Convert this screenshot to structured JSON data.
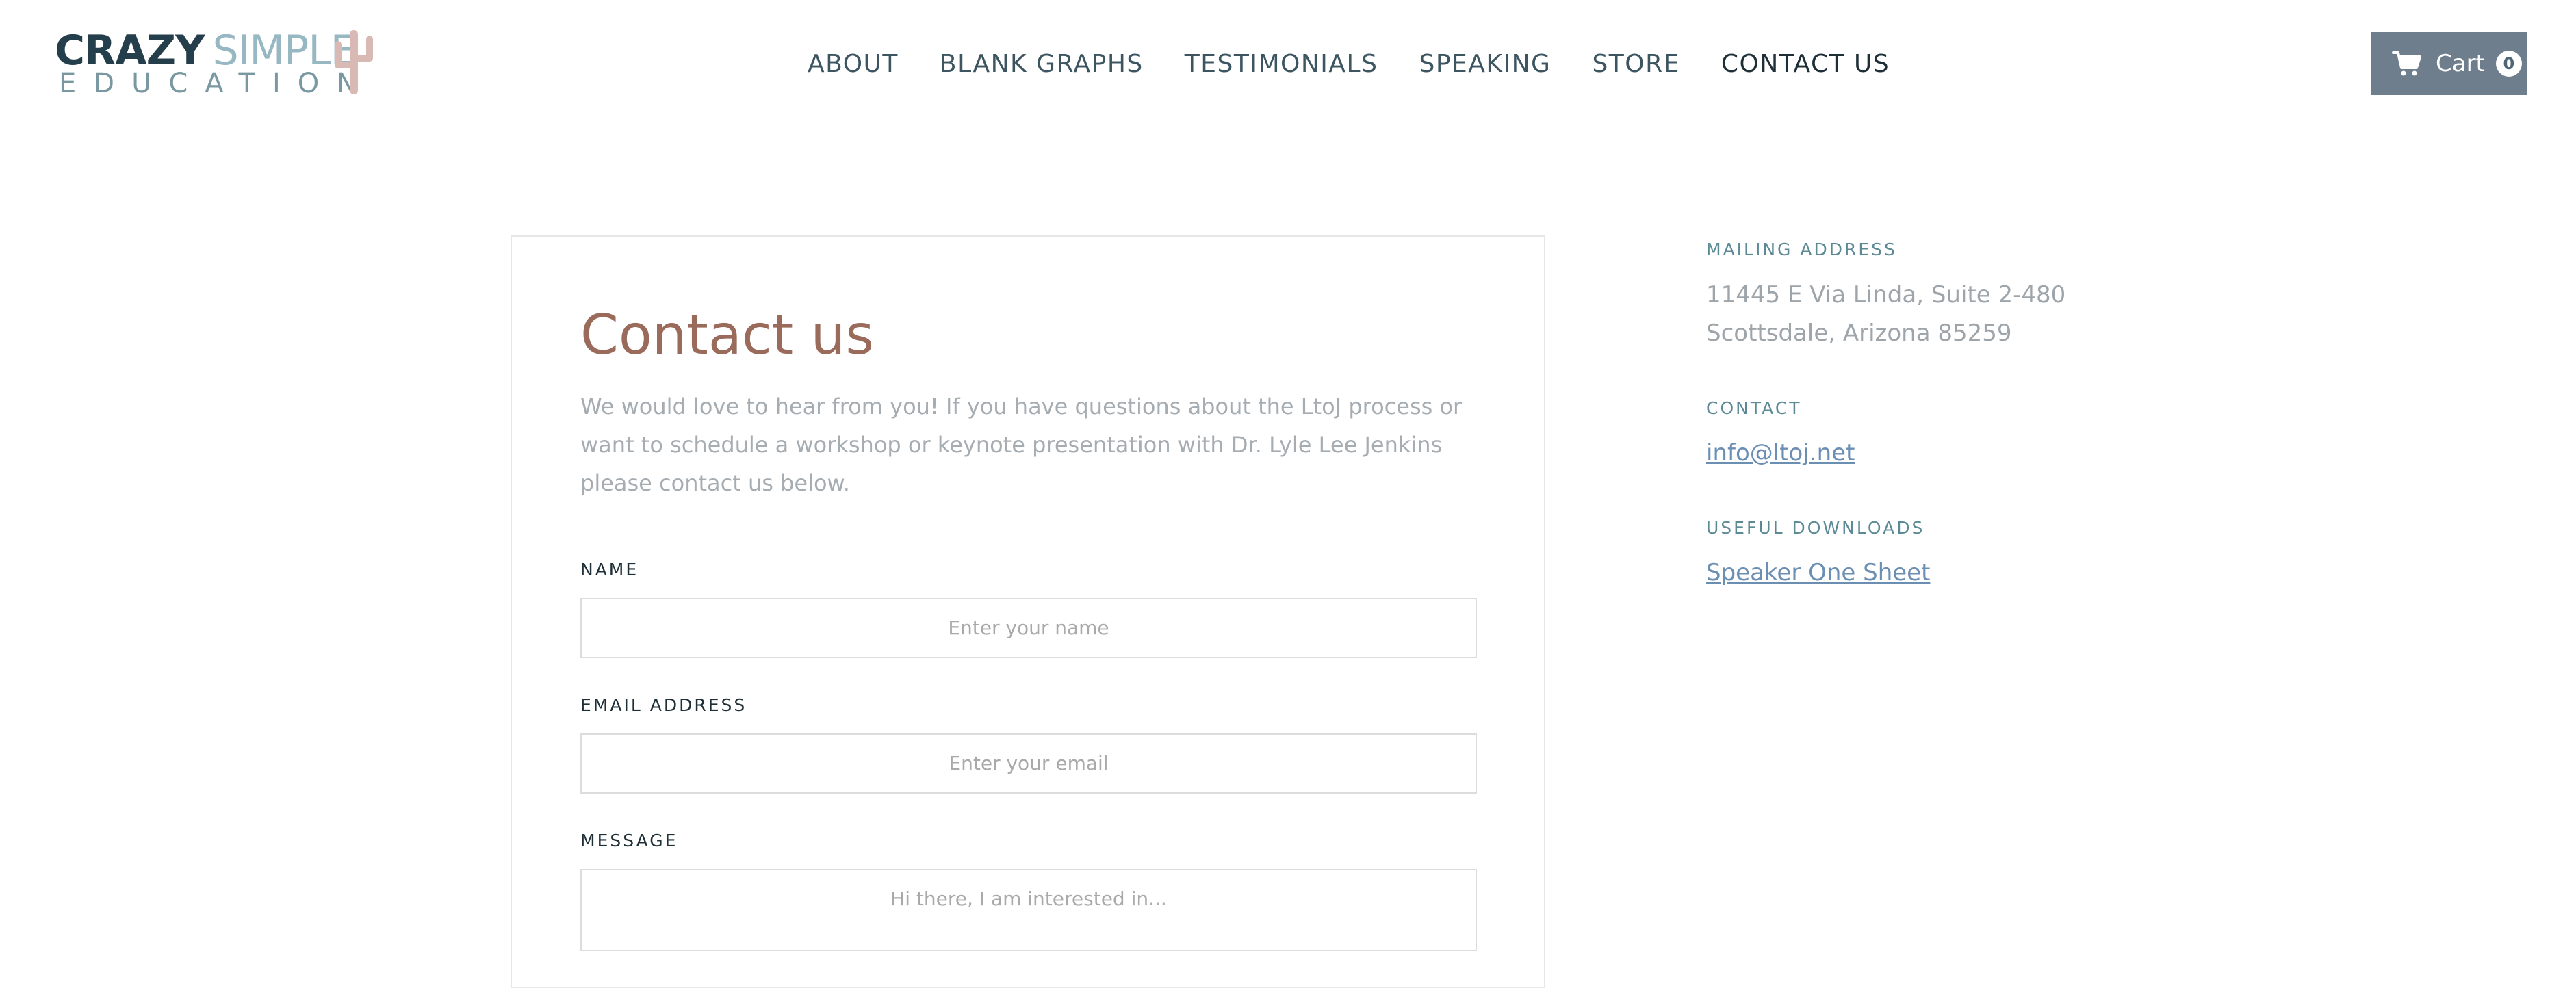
{
  "brand": {
    "line1_a": "CRAZY",
    "line1_b": "SIMPLE",
    "line2": "EDUCATION"
  },
  "nav": {
    "items": [
      {
        "label": "ABOUT"
      },
      {
        "label": "BLANK GRAPHS"
      },
      {
        "label": "TESTIMONIALS"
      },
      {
        "label": "SPEAKING"
      },
      {
        "label": "STORE"
      },
      {
        "label": "CONTACT US",
        "active": true
      }
    ]
  },
  "cart": {
    "label": "Cart",
    "count": "0",
    "icon": "cart-icon"
  },
  "form": {
    "title": "Contact us",
    "intro": "We would love to hear from you! If you have questions about the LtoJ process or want to schedule a workshop or keynote presentation with Dr. Lyle Lee Jenkins please contact us below.",
    "fields": [
      {
        "label": "NAME",
        "placeholder": "Enter your name"
      },
      {
        "label": "EMAIL ADDRESS",
        "placeholder": "Enter your email"
      },
      {
        "label": "MESSAGE",
        "placeholder": "Hi there, I am interested in..."
      }
    ]
  },
  "sidebar": {
    "mailing_label": "MAILING ADDRESS",
    "address_line1": "11445 E Via Linda, Suite 2-480",
    "address_line2": "Scottsdale, Arizona 85259",
    "contact_label": "CONTACT",
    "email_link": "info@ltoj.net",
    "downloads_label": "USEFUL DOWNLOADS",
    "download_link": "Speaker One Sheet"
  },
  "colors": {
    "title": "#9a6b5b",
    "cart_bg": "#6f7e8c",
    "link": "#6b8eb3",
    "sidebar_label": "#5b8a95"
  }
}
